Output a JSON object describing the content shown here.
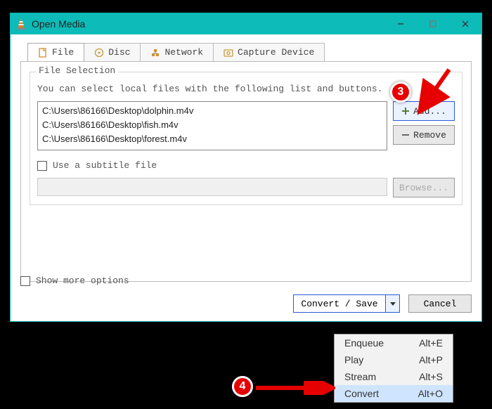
{
  "window": {
    "title": "Open Media"
  },
  "tabs": {
    "file": "File",
    "disc": "Disc",
    "network": "Network",
    "capture": "Capture Device"
  },
  "file_selection": {
    "legend": "File Selection",
    "helper": "You can select local files with the following list and buttons.",
    "files": [
      "C:\\Users\\86166\\Desktop\\dolphin.m4v",
      "C:\\Users\\86166\\Desktop\\fish.m4v",
      "C:\\Users\\86166\\Desktop\\forest.m4v"
    ],
    "add_label": "Add...",
    "remove_label": "Remove"
  },
  "subtitle": {
    "checkbox_label": "Use a subtitle file",
    "browse_label": "Browse..."
  },
  "more_options_label": "Show more options",
  "buttons": {
    "convert_save": "Convert / Save",
    "cancel": "Cancel"
  },
  "dropdown": {
    "items": [
      {
        "label": "Enqueue",
        "shortcut": "Alt+E"
      },
      {
        "label": "Play",
        "shortcut": "Alt+P"
      },
      {
        "label": "Stream",
        "shortcut": "Alt+S"
      },
      {
        "label": "Convert",
        "shortcut": "Alt+O"
      }
    ]
  },
  "annotations": {
    "badge3": "3",
    "badge4": "4"
  }
}
